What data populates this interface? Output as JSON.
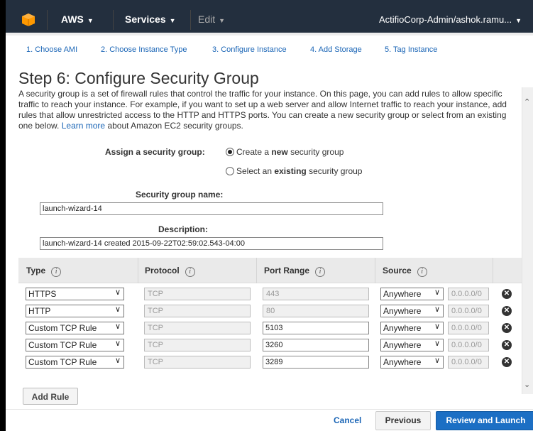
{
  "nav": {
    "aws_label": "AWS",
    "services_label": "Services",
    "edit_label": "Edit",
    "user_label": "ActifioCorp-Admin/ashok.ramu...",
    "brand_color": "#f90"
  },
  "steps": [
    {
      "label": "1. Choose AMI"
    },
    {
      "label": "2. Choose Instance Type"
    },
    {
      "label": "3. Configure Instance"
    },
    {
      "label": "4. Add Storage"
    },
    {
      "label": "5. Tag Instance"
    }
  ],
  "page": {
    "title": "Step 6: Configure Security Group",
    "description": "A security group is a set of firewall rules that control the traffic for your instance. On this page, you can add rules to allow specific traffic to reach your instance. For example, if you want to set up a web server and allow Internet traffic to reach your instance, add rules that allow unrestricted access to the HTTP and HTTPS ports. You can create a new security group or select from an existing one below.",
    "learn_more": "Learn more",
    "description_tail": "about Amazon EC2 security groups."
  },
  "assign": {
    "label": "Assign a security group:",
    "option_new_pre": "Create a",
    "option_new_bold": "new",
    "option_new_post": "security group",
    "option_existing_pre": "Select an",
    "option_existing_bold": "existing",
    "option_existing_post": "security group",
    "selected": "new"
  },
  "form": {
    "name_label": "Security group name:",
    "name_value": "launch-wizard-14",
    "description_label": "Description:",
    "description_value": "launch-wizard-14 created 2015-09-22T02:59:02.543-04:00"
  },
  "table": {
    "headers": [
      "Type",
      "Protocol",
      "Port Range",
      "Source"
    ],
    "info_glyph": "i",
    "rules": [
      {
        "type": "HTTPS",
        "protocol": "TCP",
        "port": "443",
        "port_editable": false,
        "source": "Anywhere",
        "cidr": "0.0.0.0/0"
      },
      {
        "type": "HTTP",
        "protocol": "TCP",
        "port": "80",
        "port_editable": false,
        "source": "Anywhere",
        "cidr": "0.0.0.0/0"
      },
      {
        "type": "Custom TCP Rule",
        "protocol": "TCP",
        "port": "5103",
        "port_editable": true,
        "source": "Anywhere",
        "cidr": "0.0.0.0/0"
      },
      {
        "type": "Custom TCP Rule",
        "protocol": "TCP",
        "port": "3260",
        "port_editable": true,
        "source": "Anywhere",
        "cidr": "0.0.0.0/0"
      },
      {
        "type": "Custom TCP Rule",
        "protocol": "TCP",
        "port": "3289",
        "port_editable": true,
        "source": "Anywhere",
        "cidr": "0.0.0.0/0"
      }
    ]
  },
  "actions": {
    "add_rule": "Add Rule",
    "cancel": "Cancel",
    "previous": "Previous",
    "review": "Review and Launch",
    "primary_color": "#1c6fc4"
  }
}
